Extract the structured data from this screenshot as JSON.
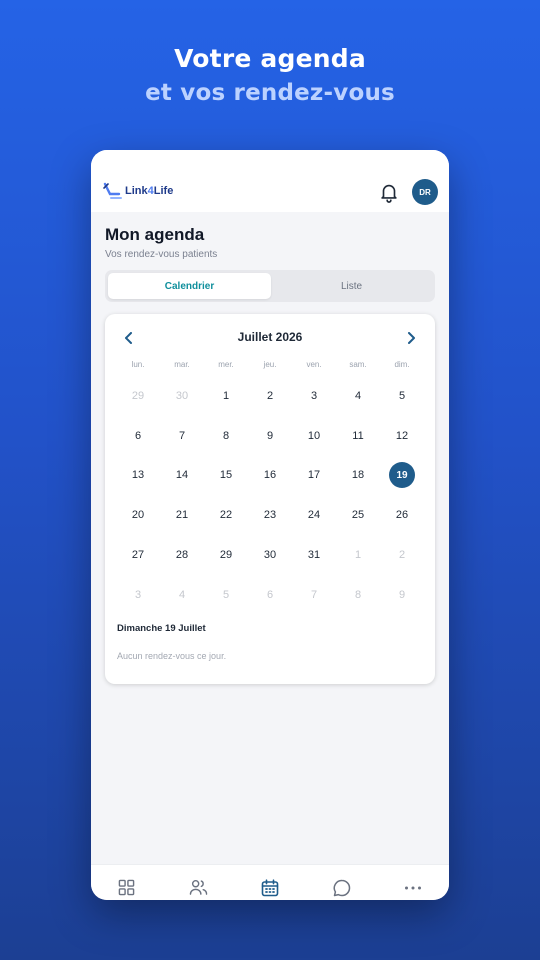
{
  "promo": {
    "title": "Votre agenda",
    "subtitle": "et vos rendez-vous"
  },
  "header": {
    "logo_text_a": "Link",
    "logo_text_b": "4",
    "logo_text_c": "Life",
    "bell_icon": "bell-icon",
    "avatar_initials": "DR"
  },
  "page": {
    "title": "Mon agenda",
    "subtitle": "Vos rendez-vous patients"
  },
  "tabs": {
    "calendar": "Calendrier",
    "list": "Liste",
    "active": "calendar"
  },
  "calendar": {
    "month_label": "Juillet 2026",
    "weekdays": [
      "lun.",
      "mar.",
      "mer.",
      "jeu.",
      "ven.",
      "sam.",
      "dim."
    ],
    "weeks": [
      [
        "29",
        "30",
        "1",
        "2",
        "3",
        "4",
        "5"
      ],
      [
        "6",
        "7",
        "8",
        "9",
        "10",
        "11",
        "12"
      ],
      [
        "13",
        "14",
        "15",
        "16",
        "17",
        "18",
        "19"
      ],
      [
        "20",
        "21",
        "22",
        "23",
        "24",
        "25",
        "26"
      ],
      [
        "27",
        "28",
        "29",
        "30",
        "31",
        "1",
        "2"
      ],
      [
        "3",
        "4",
        "5",
        "6",
        "7",
        "8",
        "9"
      ]
    ],
    "selected_day": "19",
    "selected_date_label": "Dimanche 19 Juillet",
    "empty_message": "Aucun rendez-vous ce jour."
  },
  "bottom_nav": [
    {
      "icon": "dashboard-grid-icon"
    },
    {
      "icon": "users-icon"
    },
    {
      "icon": "calendar-icon",
      "active": true
    },
    {
      "icon": "chat-bubble-icon"
    },
    {
      "icon": "more-dots-icon"
    }
  ],
  "colors": {
    "primary": "#1f5c8b",
    "accent_tab": "#0f8f9c",
    "bg_gradient_top": "#2563e6",
    "bg_gradient_bottom": "#1c3f93"
  }
}
